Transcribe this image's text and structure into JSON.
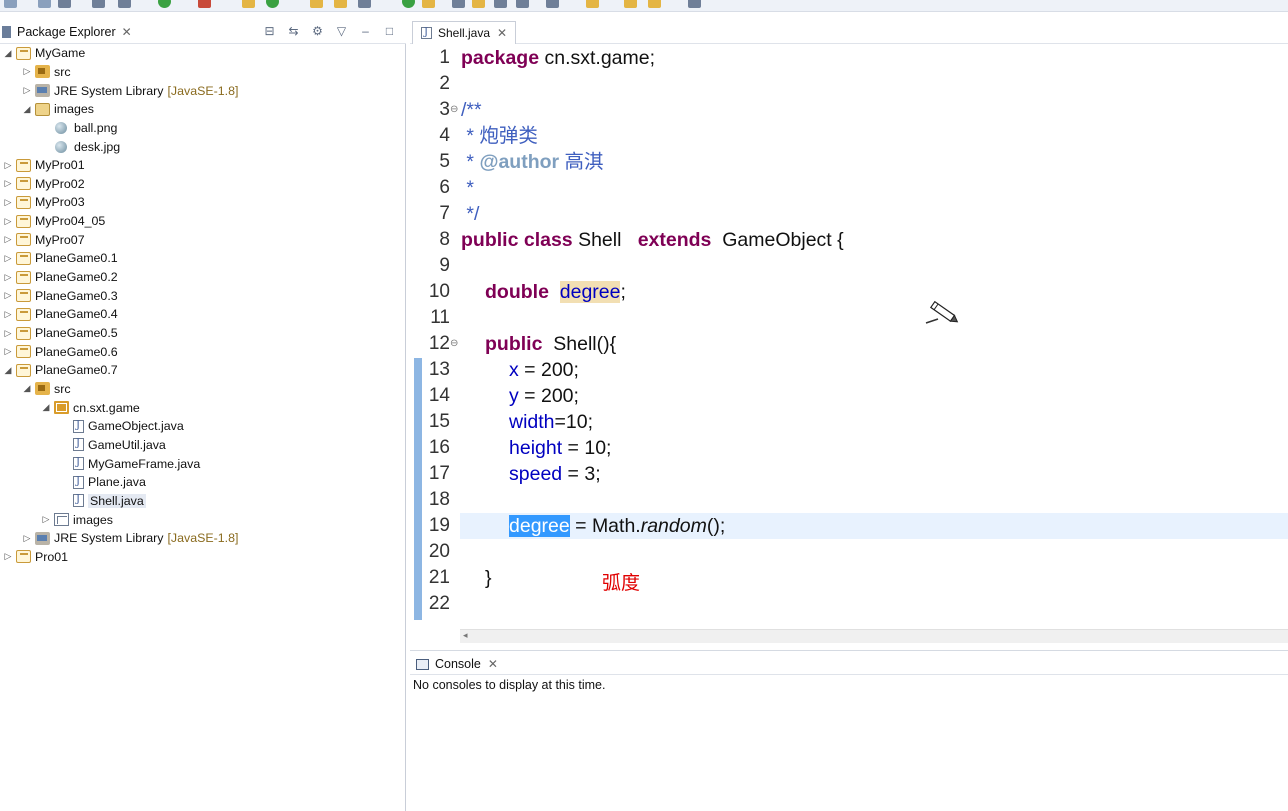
{
  "package_explorer": {
    "title": "Package Explorer",
    "tree": [
      {
        "label": "MyGame",
        "kind": "project",
        "expanded": true
      },
      {
        "label": "src",
        "kind": "src",
        "expanded": false
      },
      {
        "label": "JRE System Library",
        "tag": "[JavaSE-1.8]",
        "kind": "lib",
        "expanded": false
      },
      {
        "label": "images",
        "kind": "folder",
        "expanded": true
      },
      {
        "label": "ball.png",
        "kind": "image"
      },
      {
        "label": "desk.jpg",
        "kind": "image"
      },
      {
        "label": "MyPro01",
        "kind": "project",
        "expanded": false
      },
      {
        "label": "MyPro02",
        "kind": "project",
        "expanded": false
      },
      {
        "label": "MyPro03",
        "kind": "project",
        "expanded": false
      },
      {
        "label": "MyPro04_05",
        "kind": "project",
        "expanded": false
      },
      {
        "label": "MyPro07",
        "kind": "project",
        "expanded": false
      },
      {
        "label": "PlaneGame0.1",
        "kind": "project",
        "expanded": false
      },
      {
        "label": "PlaneGame0.2",
        "kind": "project",
        "expanded": false
      },
      {
        "label": "PlaneGame0.3",
        "kind": "project",
        "expanded": false
      },
      {
        "label": "PlaneGame0.4",
        "kind": "project",
        "expanded": false
      },
      {
        "label": "PlaneGame0.5",
        "kind": "project",
        "expanded": false
      },
      {
        "label": "PlaneGame0.6",
        "kind": "project",
        "expanded": false
      },
      {
        "label": "PlaneGame0.7",
        "kind": "project",
        "expanded": true
      },
      {
        "label": "src",
        "kind": "src",
        "expanded": true
      },
      {
        "label": "cn.sxt.game",
        "kind": "package",
        "expanded": true
      },
      {
        "label": "GameObject.java",
        "kind": "java"
      },
      {
        "label": "GameUtil.java",
        "kind": "java"
      },
      {
        "label": "MyGameFrame.java",
        "kind": "java"
      },
      {
        "label": "Plane.java",
        "kind": "java"
      },
      {
        "label": "Shell.java",
        "kind": "java",
        "selected": true
      },
      {
        "label": "images",
        "kind": "imgfolder",
        "expanded": false
      },
      {
        "label": "JRE System Library",
        "tag": "[JavaSE-1.8]",
        "kind": "lib",
        "expanded": false
      },
      {
        "label": "Pro01",
        "kind": "project",
        "expanded": false
      }
    ]
  },
  "editor": {
    "tab_label": "Shell.java",
    "line_numbers": [
      "1",
      "2",
      "3",
      "4",
      "5",
      "6",
      "7",
      "8",
      "9",
      "10",
      "11",
      "12",
      "13",
      "14",
      "15",
      "16",
      "17",
      "18",
      "19",
      "20",
      "21",
      "22"
    ],
    "code": {
      "l1_kw": "package",
      "l1_rest": " cn.sxt.game;",
      "l3": "/**",
      "l4": " * 炮弹类",
      "l5_star": " * ",
      "l5_ann": "@author",
      "l5_rest": " 高淇",
      "l6": " *",
      "l7": " */",
      "l8_kw1": "public",
      "l8_kw2": "class",
      "l8_name": " Shell   ",
      "l8_kw3": "extends",
      "l8_rest": "  GameObject {",
      "l10_kw": "double",
      "l10_field": "degree",
      "l10_rest": ";",
      "l12_kw": "public",
      "l12_rest": "  Shell(){",
      "l13_field": "x",
      "l13_rest": " = 200;",
      "l14_field": "y",
      "l14_rest": " = 200;",
      "l15_field": "width",
      "l15_rest": "=10;",
      "l16_field": "height",
      "l16_rest": " = 10;",
      "l17_field": "speed",
      "l17_rest": " = 3;",
      "l19_field": "degree",
      "l19_mid": " = Math.",
      "l19_method": "random",
      "l19_rest": "();",
      "l21": "}"
    },
    "annotation_text": "弧度"
  },
  "console": {
    "title": "Console",
    "message": "No consoles to display at this time."
  },
  "colors": {
    "keyword": "#7f0055",
    "field": "#0000c0",
    "comment": "#3f5fbf",
    "annotation": "#e00000",
    "selection": "#3399ff"
  }
}
